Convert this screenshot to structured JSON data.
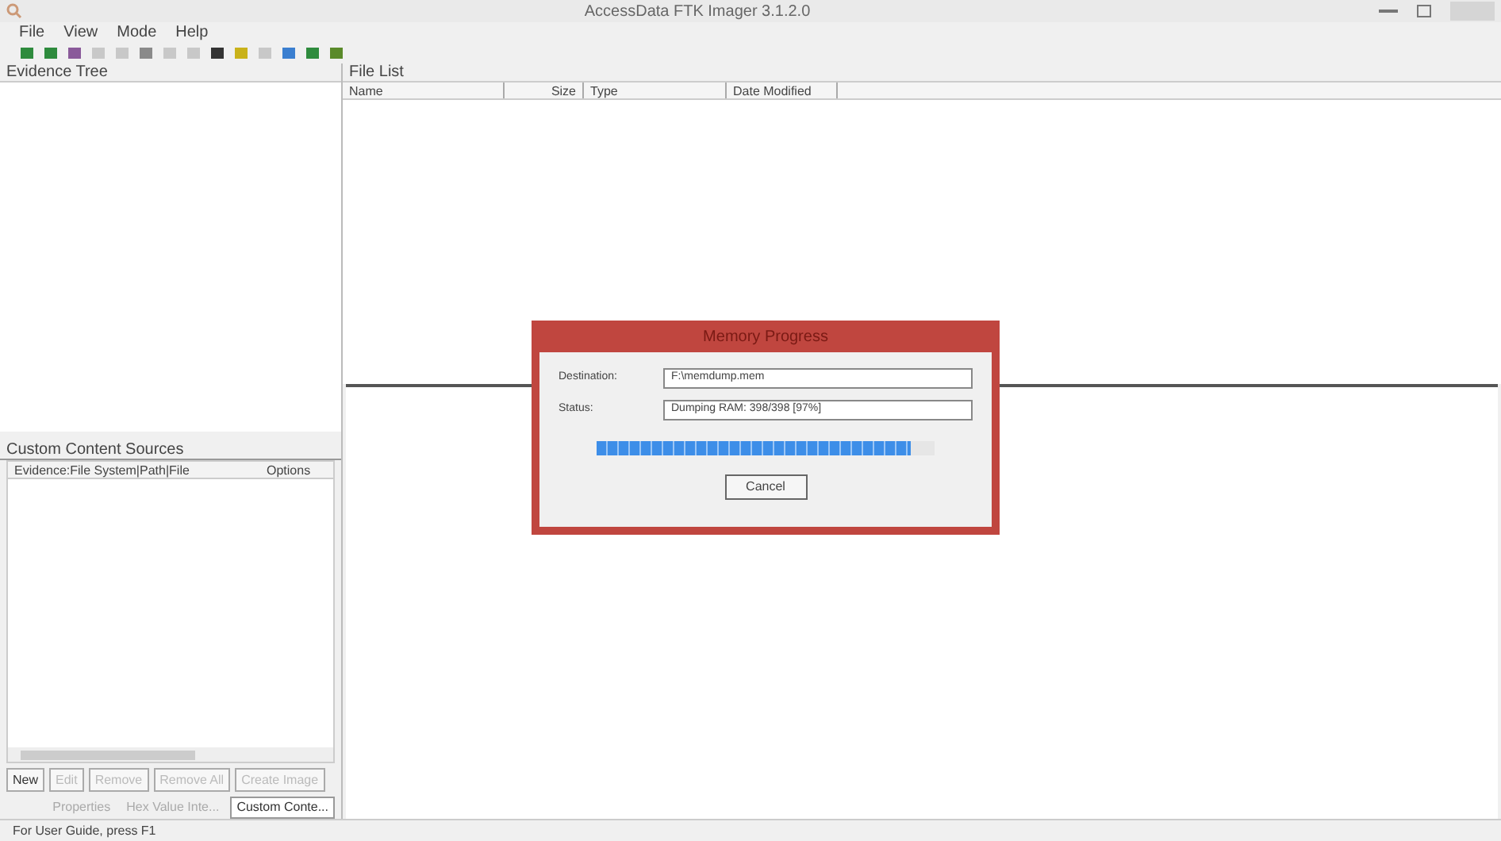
{
  "window": {
    "title": "AccessData FTK Imager 3.1.2.0"
  },
  "menu": [
    "File",
    "View",
    "Mode",
    "Help"
  ],
  "evidence_tree": {
    "title": "Evidence Tree"
  },
  "file_list": {
    "title": "File List",
    "columns": [
      "Name",
      "Size",
      "Type",
      "Date Modified"
    ]
  },
  "custom_content": {
    "title": "Custom Content Sources",
    "columns": [
      "Evidence:File System|Path|File",
      "Options"
    ],
    "buttons": [
      {
        "label": "New",
        "disabled": false
      },
      {
        "label": "Edit",
        "disabled": true
      },
      {
        "label": "Remove",
        "disabled": true
      },
      {
        "label": "Remove All",
        "disabled": true
      },
      {
        "label": "Create Image",
        "disabled": true
      }
    ]
  },
  "bottom_tabs": [
    {
      "label": "Properties",
      "selected": false
    },
    {
      "label": "Hex Value Inte...",
      "selected": false
    },
    {
      "label": "Custom Conte...",
      "selected": true
    }
  ],
  "dialog": {
    "title": "Memory Progress",
    "fields": [
      {
        "label": "Destination:",
        "value": "F:\\memdump.mem"
      },
      {
        "label": "Status:",
        "value": "Dumping RAM: 398/398 [97%]"
      }
    ],
    "progress": {
      "level": 0.93
    },
    "button": "Cancel"
  },
  "status_bar": "For User Guide, press F1"
}
